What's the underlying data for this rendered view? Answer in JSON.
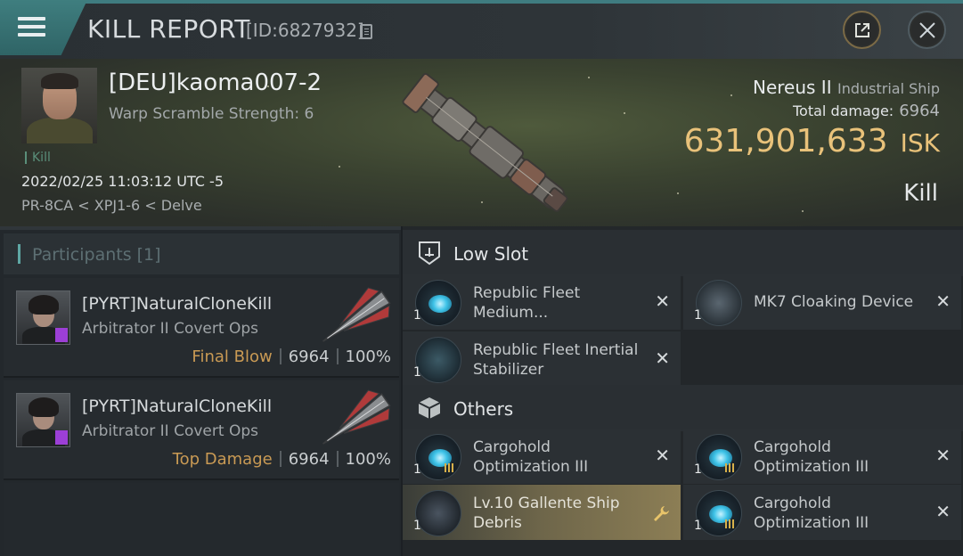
{
  "window": {
    "title": "KILL REPORT",
    "report_id": "[ID:6827932]"
  },
  "victim": {
    "name": "[DEU]kaoma007-2",
    "warp_scramble": "Warp Scramble Strength: 6",
    "kill_tag": "Kill",
    "datetime": "2022/02/25 11:03:12 UTC -5",
    "location": "PR-8CA < XPJ1-6 < Delve",
    "ship_name": "Nereus II",
    "ship_class": "Industrial Ship",
    "total_damage_label": "Total damage:",
    "total_damage_value": "6964",
    "isk_value": "631,901,633",
    "isk_unit": "ISK",
    "result_label": "Kill"
  },
  "participants": {
    "header": "Participants [1]",
    "rows": [
      {
        "name": "[PYRT]NaturalCloneKill",
        "ship": "Arbitrator II Covert Ops",
        "role": "Final Blow",
        "damage": "6964",
        "percent": "100%"
      },
      {
        "name": "[PYRT]NaturalCloneKill",
        "ship": "Arbitrator II Covert Ops",
        "role": "Top Damage",
        "damage": "6964",
        "percent": "100%"
      }
    ]
  },
  "fitting": {
    "low_slot_header": "Low Slot",
    "others_header": "Others",
    "low_slot_items": [
      {
        "qty": "1",
        "name": "Republic Fleet Medium...",
        "icon": "plate-module-icon"
      },
      {
        "qty": "1",
        "name": "MK7 Cloaking Device",
        "icon": "cloaking-device-icon"
      },
      {
        "qty": "1",
        "name": "Republic Fleet Inertial Stabilizer",
        "icon": "inertial-stabilizer-icon"
      }
    ],
    "other_items": [
      {
        "qty": "1",
        "name": "Cargohold Optimization III",
        "icon": "cargohold-rig-icon"
      },
      {
        "qty": "1",
        "name": "Cargohold Optimization III",
        "icon": "cargohold-rig-icon"
      },
      {
        "qty": "1",
        "name": "Lv.10 Gallente Ship Debris",
        "icon": "ship-debris-icon"
      },
      {
        "qty": "1",
        "name": "Cargohold Optimization III",
        "icon": "cargohold-rig-icon"
      }
    ]
  },
  "colors": {
    "accent_teal": "#3f7e7f",
    "isk_gold": "#e9c27a",
    "role_orange": "#c99a54",
    "highlight": "#8c7e55"
  }
}
